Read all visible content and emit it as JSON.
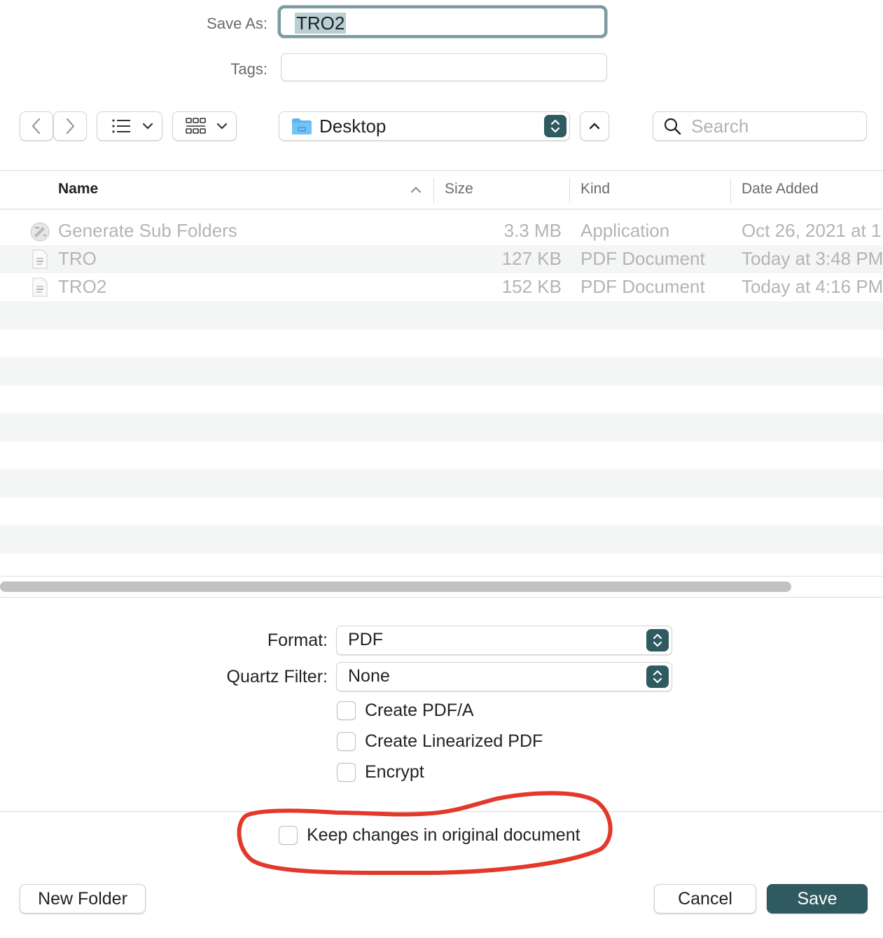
{
  "save_as": {
    "label": "Save As:",
    "value": "TRO2"
  },
  "tags": {
    "label": "Tags:",
    "value": ""
  },
  "toolbar": {
    "back_icon": "chevron-left-icon",
    "forward_icon": "chevron-right-icon",
    "list_view_icon": "list-icon",
    "grid_view_icon": "grid-icon",
    "location": "Desktop",
    "search_placeholder": "Search"
  },
  "table": {
    "columns": [
      "Name",
      "Size",
      "Kind",
      "Date Added"
    ],
    "rows": [
      {
        "name": "Generate Sub Folders",
        "size": "3.3 MB",
        "kind": "Application",
        "date": "Oct 26, 2021 at 1"
      },
      {
        "name": "TRO",
        "size": "127 KB",
        "kind": "PDF Document",
        "date": "Today at 3:48 PM"
      },
      {
        "name": "TRO2",
        "size": "152 KB",
        "kind": "PDF Document",
        "date": "Today at 4:16 PM"
      }
    ]
  },
  "options": {
    "format_label": "Format:",
    "format_value": "PDF",
    "quartz_label": "Quartz Filter:",
    "quartz_value": "None",
    "checkboxes": [
      {
        "label": "Create PDF/A",
        "checked": false
      },
      {
        "label": "Create Linearized PDF",
        "checked": false
      },
      {
        "label": "Encrypt",
        "checked": false
      }
    ],
    "keep_changes": {
      "label": "Keep changes in original document",
      "checked": false
    }
  },
  "buttons": {
    "new_folder": "New Folder",
    "cancel": "Cancel",
    "save": "Save"
  },
  "colors": {
    "accent": "#2f5a5f",
    "annotation": "#e2392b"
  }
}
